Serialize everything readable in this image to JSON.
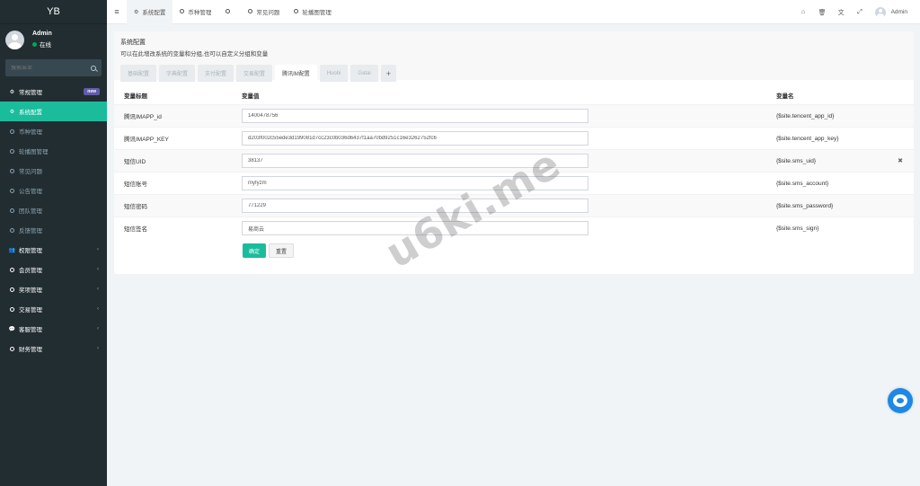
{
  "app": {
    "logo": "YB"
  },
  "user": {
    "name": "Admin",
    "status": "在线"
  },
  "search": {
    "placeholder": "搜索菜单"
  },
  "sidebar": {
    "items": [
      {
        "label": "常规管理",
        "badge": "new",
        "type": "header",
        "icon": "gears-icon"
      },
      {
        "label": "系统配置",
        "type": "sub",
        "active": true,
        "icon": "gear-icon"
      },
      {
        "label": "币种管理",
        "type": "sub",
        "icon": "circle-o-icon"
      },
      {
        "label": "轮播图管理",
        "type": "sub",
        "icon": "circle-o-icon"
      },
      {
        "label": "常见问题",
        "type": "sub",
        "icon": "circle-o-icon"
      },
      {
        "label": "公告管理",
        "type": "sub",
        "icon": "circle-o-icon"
      },
      {
        "label": "团队管理",
        "type": "sub",
        "icon": "circle-o-icon"
      },
      {
        "label": "反馈管理",
        "type": "sub",
        "icon": "circle-o-icon"
      },
      {
        "label": "权限管理",
        "type": "group",
        "icon": "group-icon"
      },
      {
        "label": "会员管理",
        "type": "group",
        "icon": "circle-o-icon"
      },
      {
        "label": "奖项管理",
        "type": "group",
        "icon": "circle-o-icon"
      },
      {
        "label": "交易管理",
        "type": "group",
        "icon": "circle-o-icon"
      },
      {
        "label": "客服管理",
        "type": "group",
        "icon": "comment-icon"
      },
      {
        "label": "财务管理",
        "type": "group",
        "icon": "circle-o-icon"
      }
    ]
  },
  "navbar": {
    "tabs": [
      {
        "label": "系统配置",
        "active": true,
        "icon": "gear-icon"
      },
      {
        "label": "币种管理",
        "icon": "circle-o-icon"
      },
      {
        "label": "",
        "icon": "circle-o-icon"
      },
      {
        "label": "常见问题",
        "icon": "circle-o-icon"
      },
      {
        "label": "轮播图管理",
        "icon": "circle-o-icon"
      }
    ],
    "right_icons": [
      "home-icon",
      "trash-icon",
      "language-icon",
      "fullscreen-icon"
    ],
    "user_name": "Admin"
  },
  "page": {
    "title": "系统配置",
    "description": "可以在此增改系统的变量和分组,也可以自定义分组和变量",
    "tabs": [
      "基础配置",
      "字典配置",
      "支付配置",
      "交易配置",
      "腾讯IM配置",
      "Huobi",
      "Gatai",
      "+"
    ],
    "active_tab_index": 4
  },
  "table": {
    "headers": [
      "变量标题",
      "变量值",
      "变量名"
    ],
    "rows": [
      {
        "title": "腾讯IMAPP_id",
        "value": "1400478756",
        "name": "{$site.tencent_app_id}"
      },
      {
        "title": "腾讯IMAPP_KEY",
        "value": "d203f002c55ede3d199081d7cc23c0b036d6437f1aa70bd9251c16e3262752fc6",
        "name": "{$site.tencent_app_key}"
      },
      {
        "title": "短信UID",
        "value": "38137",
        "name": "{$site.sms_uid}",
        "deletable": true
      },
      {
        "title": "短信账号",
        "value": "myfyzm",
        "name": "{$site.sms_account}"
      },
      {
        "title": "短信密码",
        "value": "771229",
        "name": "{$site.sms_password}"
      },
      {
        "title": "短信签名",
        "value": "易商云",
        "name": "{$site.sms_sign}"
      }
    ]
  },
  "buttons": {
    "ok": "确定",
    "reset": "重置"
  },
  "watermark": "u6ki.me",
  "colors": {
    "accent": "#1abc9c",
    "sidebar_bg": "#222d32",
    "badge": "#605ca8",
    "chat": "#1e88e5"
  }
}
